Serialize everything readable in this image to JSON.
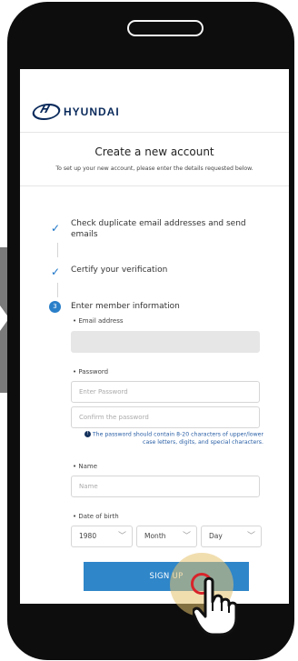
{
  "brand": {
    "name": "HYUNDAI"
  },
  "header": {
    "title": "Create a new account",
    "subtitle": "To set up your new account, please enter the details requested below."
  },
  "steps": [
    {
      "status": "done",
      "text": "Check duplicate email addresses and send emails"
    },
    {
      "status": "done",
      "text": "Certify your verification"
    },
    {
      "status": "current",
      "number": "3",
      "text": "Enter member information"
    }
  ],
  "form": {
    "email": {
      "label": "• Email address",
      "value": ""
    },
    "password": {
      "label": "• Password",
      "placeholder": "Enter Password",
      "confirm_placeholder": "Confirm the password",
      "hint": "The password should contain 8-20 characters of upper/lower case letters, digits, and special characters."
    },
    "name": {
      "label": "• Name",
      "placeholder": "Name"
    },
    "dob": {
      "label": "• Date of birth",
      "year": "1980",
      "month": "Month",
      "day": "Day"
    }
  },
  "signup": {
    "label": "SIGN UP"
  },
  "colors": {
    "accent": "#2f86c9",
    "brand": "#0a2a5b",
    "touch": "#d8232a"
  }
}
